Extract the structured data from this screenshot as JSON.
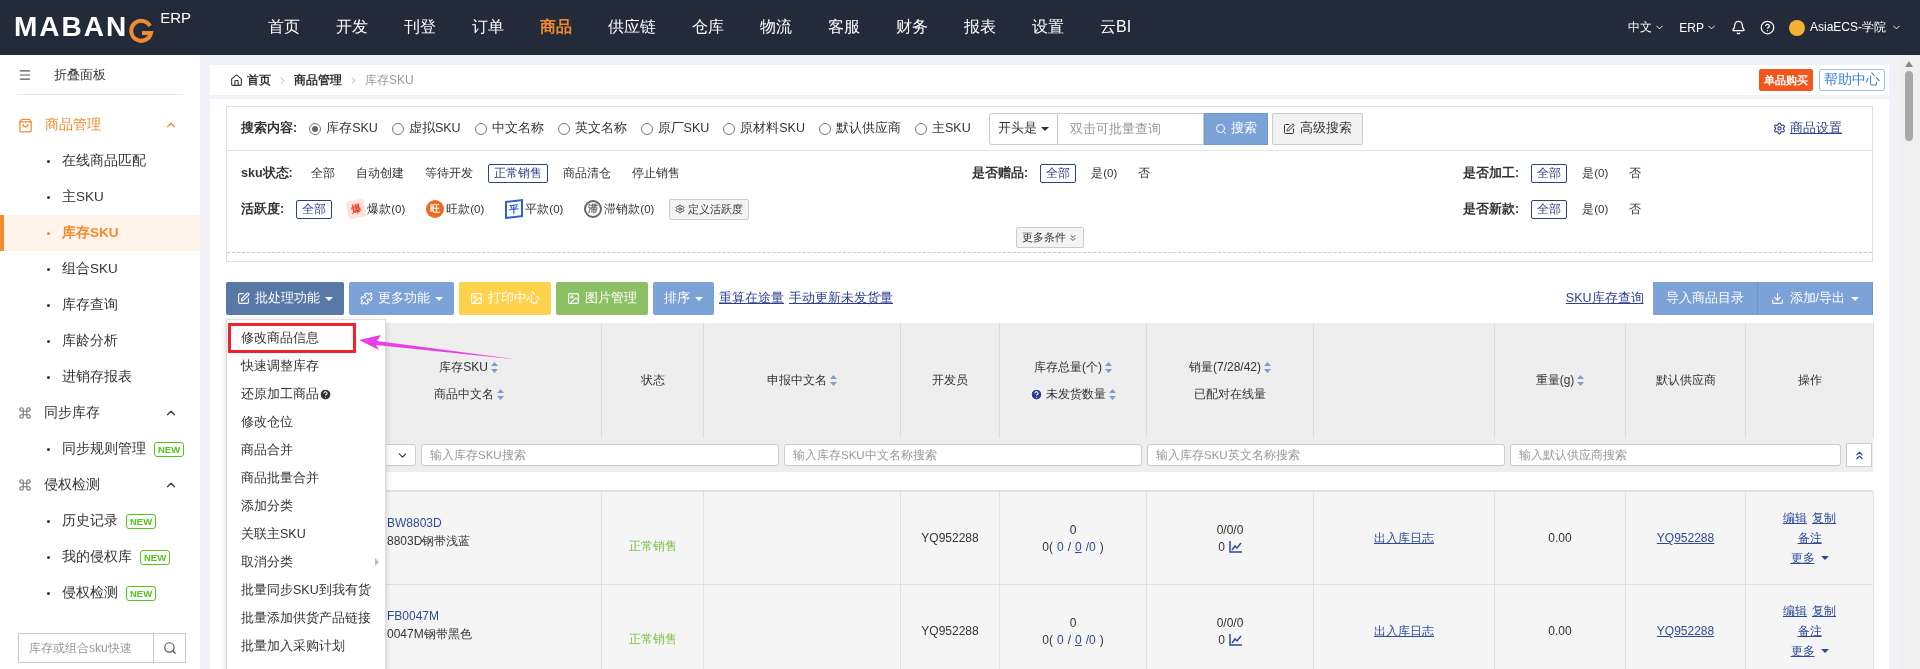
{
  "app": {
    "logo": "MABAN",
    "logo_suffix": "ERP"
  },
  "nav": [
    {
      "label": "首页",
      "selected": false
    },
    {
      "label": "开发",
      "selected": false
    },
    {
      "label": "刊登",
      "selected": false
    },
    {
      "label": "订单",
      "selected": false
    },
    {
      "label": "商品",
      "selected": true
    },
    {
      "label": "供应链",
      "selected": false
    },
    {
      "label": "仓库",
      "selected": false
    },
    {
      "label": "物流",
      "selected": false
    },
    {
      "label": "客服",
      "selected": false
    },
    {
      "label": "财务",
      "selected": false
    },
    {
      "label": "报表",
      "selected": false
    },
    {
      "label": "设置",
      "selected": false
    },
    {
      "label": "云BI",
      "selected": false
    }
  ],
  "top_right": {
    "language": "中文",
    "product": "ERP",
    "user": "AsiaECS-学院"
  },
  "sidebar": {
    "collapse_label": "折叠面板",
    "groups": [
      {
        "label": "商品管理",
        "kind": "bag",
        "active": true,
        "expanded": true,
        "children": [
          {
            "label": "在线商品匹配",
            "selected": false,
            "new": false
          },
          {
            "label": "主SKU",
            "selected": false,
            "new": false
          },
          {
            "label": "库存SKU",
            "selected": true,
            "new": false
          },
          {
            "label": "组合SKU",
            "selected": false,
            "new": false
          },
          {
            "label": "库存查询",
            "selected": false,
            "new": false
          },
          {
            "label": "库龄分析",
            "selected": false,
            "new": false
          },
          {
            "label": "进销存报表",
            "selected": false,
            "new": false
          }
        ]
      },
      {
        "label": "同步库存",
        "kind": "command",
        "active": false,
        "expanded": true,
        "children": [
          {
            "label": "同步规则管理",
            "selected": false,
            "new": true,
            "badge": "NEW"
          }
        ]
      },
      {
        "label": "侵权检测",
        "kind": "command",
        "active": false,
        "expanded": true,
        "children": [
          {
            "label": "历史记录",
            "selected": false,
            "new": true,
            "badge": "NEW"
          },
          {
            "label": "我的侵权库",
            "selected": false,
            "new": true,
            "badge": "NEW"
          },
          {
            "label": "侵权检测",
            "selected": false,
            "new": true,
            "badge": "NEW"
          }
        ]
      }
    ],
    "search": {
      "placeholder": "库存或组合sku快速"
    }
  },
  "breadcrumb": [
    "首页",
    "商品管理",
    "库存SKU"
  ],
  "header_buttons": {
    "buy": "单品购买",
    "help": "帮助中心"
  },
  "search": {
    "label": "搜索内容:",
    "options": [
      {
        "label": "库存SKU",
        "selected": true
      },
      {
        "label": "虚拟SKU",
        "selected": false
      },
      {
        "label": "中文名称",
        "selected": false
      },
      {
        "label": "英文名称",
        "selected": false
      },
      {
        "label": "原厂SKU",
        "selected": false
      },
      {
        "label": "原材料SKU",
        "selected": false
      },
      {
        "label": "默认供应商",
        "selected": false
      },
      {
        "label": "主SKU",
        "selected": false
      }
    ],
    "match": "开头是",
    "placeholder": "双击可批量查询",
    "search_button": "搜索",
    "advanced_button": "高级搜索",
    "settings_link": "商品设置"
  },
  "filter_rows": [
    {
      "left": {
        "label": "sku状态:",
        "options": [
          {
            "label": "全部",
            "selected": false
          },
          {
            "label": "自动创建",
            "selected": false
          },
          {
            "label": "等待开发",
            "selected": false
          },
          {
            "label": "正常销售",
            "selected": true
          },
          {
            "label": "商品清仓",
            "selected": false
          },
          {
            "label": "停止销售",
            "selected": false
          }
        ]
      },
      "middle": {
        "label": "是否赠品:",
        "options": [
          {
            "label": "全部",
            "selected": true
          },
          {
            "label": "是(0)",
            "selected": false
          },
          {
            "label": "否",
            "selected": false
          }
        ]
      },
      "right": {
        "label": "是否加工:",
        "options": [
          {
            "label": "全部",
            "selected": true
          },
          {
            "label": "是(0)",
            "selected": false
          },
          {
            "label": "否",
            "selected": false
          }
        ]
      }
    },
    {
      "left": {
        "label": "活跃度:",
        "options": [
          {
            "label": "全部",
            "selected": true
          },
          {
            "label": "爆款(0)",
            "selected": false,
            "badge": "爆",
            "kind": "burst",
            "color": "#e8412c"
          },
          {
            "label": "旺款(0)",
            "selected": false,
            "badge": "旺",
            "kind": "round",
            "color": "#f26b1d"
          },
          {
            "label": "平款(0)",
            "selected": false,
            "badge": "平",
            "kind": "flag",
            "color": "#2f62c9"
          },
          {
            "label": "滞销款(0)",
            "selected": false,
            "badge": "滞",
            "kind": "ring",
            "color": "#666666"
          }
        ],
        "extra_button": "定义活跃度"
      },
      "right": {
        "label": "是否新款:",
        "options": [
          {
            "label": "全部",
            "selected": true
          },
          {
            "label": "是(0)",
            "selected": false
          },
          {
            "label": "否",
            "selected": false
          }
        ]
      }
    }
  ],
  "more_conditions": "更多条件",
  "toolbar": {
    "buttons": [
      {
        "label": "批处理功能",
        "kind": "batch",
        "caret": true
      },
      {
        "label": "更多功能",
        "kind": "more",
        "caret": true
      },
      {
        "label": "打印中心",
        "kind": "print",
        "caret": false
      },
      {
        "label": "图片管理",
        "kind": "images",
        "caret": false
      },
      {
        "label": "排序",
        "kind": "sort",
        "caret": true
      }
    ],
    "links": [
      "重算在途量",
      "手动更新未发货量"
    ],
    "stock_link": "SKU库存查询",
    "import_button": "导入商品目录",
    "export_button": "添加/导出"
  },
  "table": {
    "columns": [
      {
        "kind": "text",
        "lines": [
          {
            "text": "库存SKU",
            "sortable": true,
            "help": false
          },
          {
            "text": "商品中文名",
            "sortable": true,
            "help": false
          }
        ]
      },
      {
        "kind": "text",
        "lines": [
          {
            "text": "状态",
            "sortable": false,
            "help": false
          }
        ]
      },
      {
        "kind": "text",
        "lines": [
          {
            "text": "申报中文名",
            "sortable": true,
            "help": false
          }
        ]
      },
      {
        "kind": "text",
        "lines": [
          {
            "text": "开发员",
            "sortable": false,
            "help": false
          }
        ]
      },
      {
        "kind": "text",
        "lines": [
          {
            "text": "库存总量(个)",
            "sortable": true,
            "help": false
          },
          {
            "text": "未发货数量",
            "sortable": true,
            "help": true
          }
        ]
      },
      {
        "kind": "text",
        "lines": [
          {
            "text": "销量(7/28/42)",
            "sortable": true,
            "help": false
          },
          {
            "text": "已配对在线量",
            "sortable": false,
            "help": false
          }
        ]
      },
      {
        "kind": "blank"
      },
      {
        "kind": "text",
        "lines": [
          {
            "text": "重量(g)",
            "sortable": true,
            "help": false
          }
        ]
      },
      {
        "kind": "text",
        "lines": [
          {
            "text": "默认供应商",
            "sortable": false,
            "help": false
          }
        ]
      },
      {
        "kind": "text",
        "lines": [
          {
            "text": "操作",
            "sortable": false,
            "help": false
          }
        ]
      }
    ],
    "filter_inputs": [
      {
        "placeholder": "输入库存SKU搜索"
      },
      {
        "placeholder": "输入库存SKU中文名称搜索"
      },
      {
        "placeholder": "输入库存SKU英文名称搜索"
      },
      {
        "placeholder": "输入默认供应商搜索"
      }
    ],
    "rows": [
      {
        "sku": "BW8803D",
        "name": "8803D钢带浅蓝",
        "status": "正常销售",
        "developer": "YQ952288",
        "stock_total": "0",
        "stock_detail": [
          {
            "text": "0(",
            "kind": "plain"
          },
          {
            "text": "0",
            "kind": "value"
          },
          {
            "text": "/",
            "kind": "plain"
          },
          {
            "text": "0",
            "kind": "link"
          },
          {
            "text": "/0",
            "kind": "value"
          },
          {
            "text": ")",
            "kind": "plain"
          }
        ],
        "sales": "0/0/0",
        "paired": "0",
        "log": "出入库日志",
        "weight": "0.00",
        "supplier": "YQ952288",
        "actions": [
          "编辑",
          "复制",
          "备注"
        ],
        "more": "更多"
      },
      {
        "sku": "FB0047M",
        "name": "0047M钢带黑色",
        "status": "正常销售",
        "developer": "YQ952288",
        "stock_total": "0",
        "stock_detail": [
          {
            "text": "0(",
            "kind": "plain"
          },
          {
            "text": "0",
            "kind": "value"
          },
          {
            "text": "/",
            "kind": "plain"
          },
          {
            "text": "0",
            "kind": "link"
          },
          {
            "text": "/0",
            "kind": "value"
          },
          {
            "text": ")",
            "kind": "plain"
          }
        ],
        "sales": "0/0/0",
        "paired": "0",
        "log": "出入库日志",
        "weight": "0.00",
        "supplier": "YQ952288",
        "actions": [
          "编辑",
          "复制",
          "备注"
        ],
        "more": "更多"
      }
    ]
  },
  "batch_menu": {
    "items": [
      {
        "label": "修改商品信息",
        "highlighted": true,
        "help": false,
        "submenu": false
      },
      {
        "label": "快速调整库存",
        "highlighted": false,
        "help": false,
        "submenu": false
      },
      {
        "label": "还原加工商品",
        "highlighted": false,
        "help": true,
        "submenu": false
      },
      {
        "label": "修改仓位",
        "highlighted": false,
        "help": false,
        "submenu": false
      },
      {
        "label": "商品合并",
        "highlighted": false,
        "help": false,
        "submenu": false
      },
      {
        "label": "商品批量合并",
        "highlighted": false,
        "help": false,
        "submenu": false
      },
      {
        "label": "添加分类",
        "highlighted": false,
        "help": false,
        "submenu": false
      },
      {
        "label": "关联主SKU",
        "highlighted": false,
        "help": false,
        "submenu": false
      },
      {
        "label": "取消分类",
        "highlighted": false,
        "help": false,
        "submenu": true
      },
      {
        "label": "批量同步SKU到我有货",
        "highlighted": false,
        "help": false,
        "submenu": false
      },
      {
        "label": "批量添加供货产品链接",
        "highlighted": false,
        "help": false,
        "submenu": false
      },
      {
        "label": "批量加入采购计划",
        "highlighted": false,
        "help": false,
        "submenu": false
      }
    ]
  }
}
